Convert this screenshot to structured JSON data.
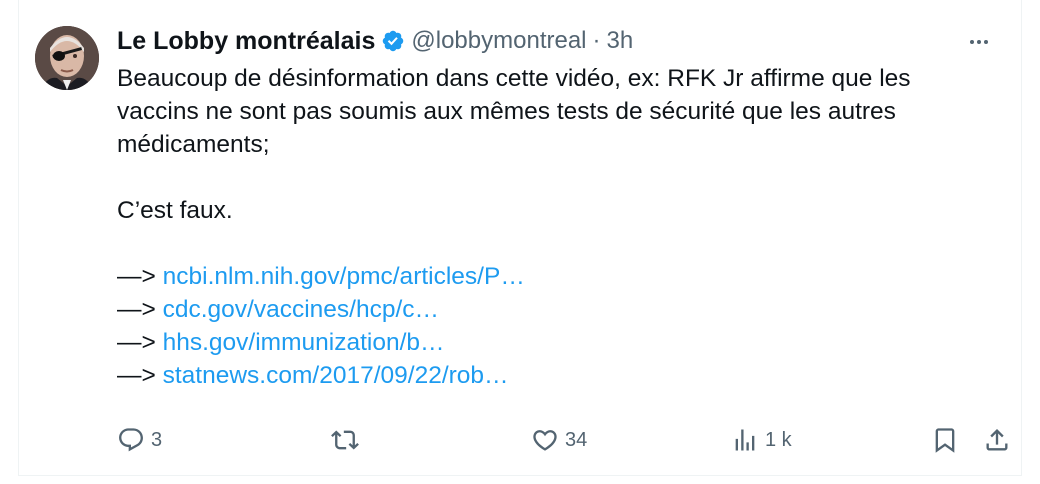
{
  "tweet": {
    "author_name": "Le Lobby montréalais",
    "handle": "@lobbymontreal",
    "separator": "·",
    "time": "3h",
    "more_icon": "more-horizontal-icon",
    "verified_icon": "verified-badge-icon",
    "verified_color": "#1d9bf0",
    "text_lines": [
      "Beaucoup de désinformation dans cette vidéo, ex: RFK Jr affirme que les vaccins ne sont pas soumis aux mêmes tests de sécurité que les autres médicaments;",
      "C’est faux."
    ],
    "links": [
      {
        "prefix": "—> ",
        "text": "ncbi.nlm.nih.gov/pmc/articles/P…"
      },
      {
        "prefix": "—> ",
        "text": "cdc.gov/vaccines/hcp/c…"
      },
      {
        "prefix": "—> ",
        "text": "hhs.gov/immunization/b…"
      },
      {
        "prefix": "—> ",
        "text": "statnews.com/2017/09/22/rob…"
      }
    ],
    "link_color": "#1d9bf0"
  },
  "actions": {
    "reply": {
      "icon": "reply-icon",
      "count": "3"
    },
    "retweet": {
      "icon": "retweet-icon",
      "count": ""
    },
    "like": {
      "icon": "heart-icon",
      "count": "34"
    },
    "views": {
      "icon": "views-chart-icon",
      "count": "1 k"
    },
    "bookmark": {
      "icon": "bookmark-icon"
    },
    "share": {
      "icon": "share-icon"
    }
  }
}
